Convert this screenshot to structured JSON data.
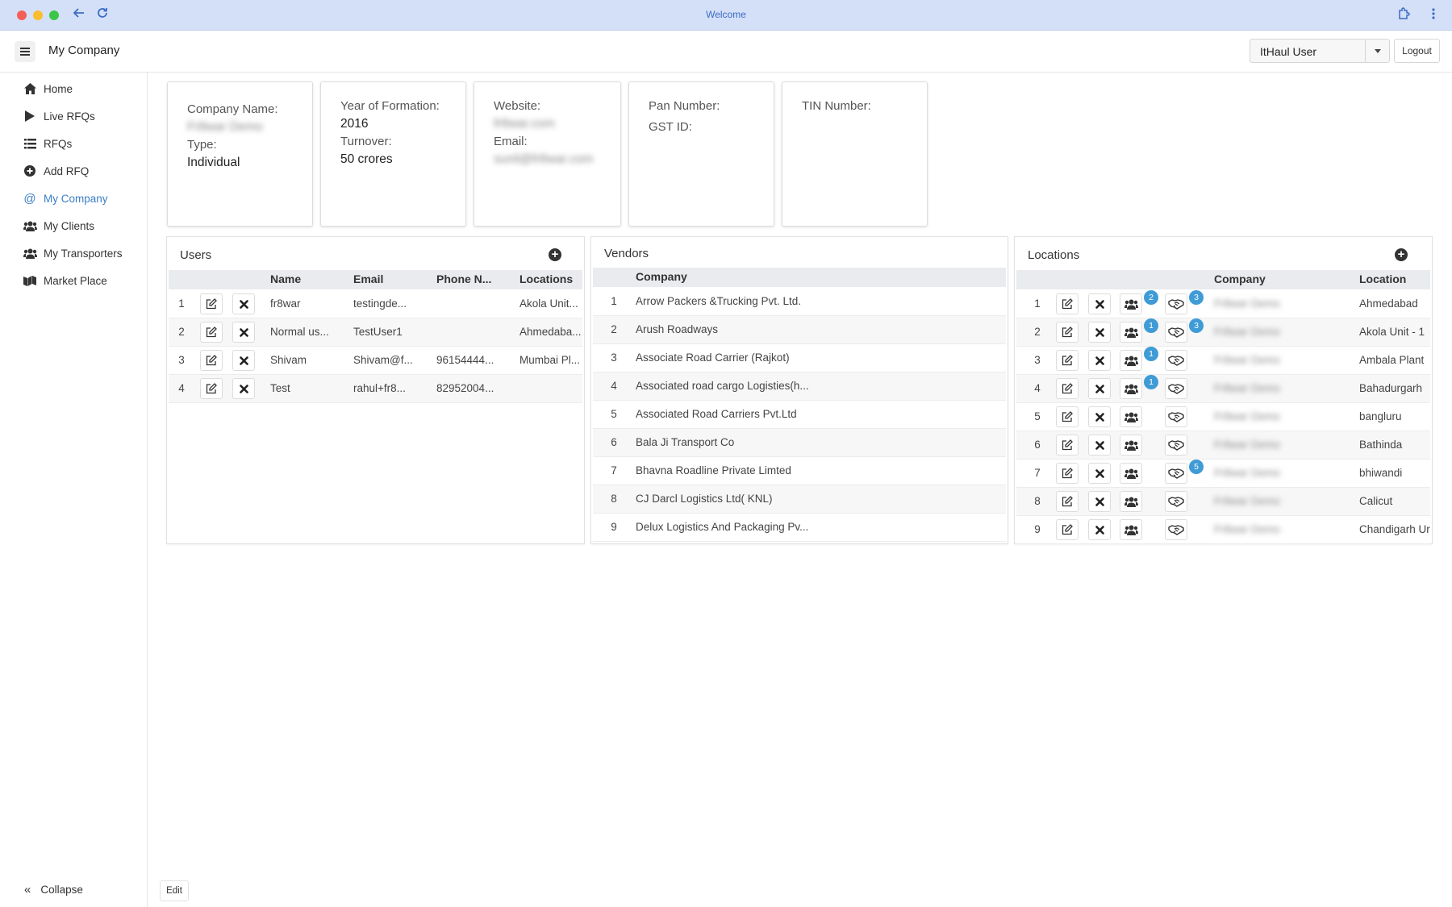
{
  "browser": {
    "title": "Welcome"
  },
  "header": {
    "title": "My Company",
    "user": "ItHaul User",
    "logout_label": "Logout"
  },
  "sidebar": {
    "items": [
      {
        "label": "Home",
        "icon": "home-icon"
      },
      {
        "label": "Live RFQs",
        "icon": "play-icon"
      },
      {
        "label": "RFQs",
        "icon": "list-icon"
      },
      {
        "label": "Add RFQ",
        "icon": "plus-circle-icon"
      },
      {
        "label": "My Company",
        "icon": "at-icon",
        "active": true
      },
      {
        "label": "My Clients",
        "icon": "users-icon"
      },
      {
        "label": "My Transporters",
        "icon": "users-icon"
      },
      {
        "label": "Market Place",
        "icon": "map-icon"
      }
    ],
    "collapse_label": "Collapse"
  },
  "edit_label": "Edit",
  "company": {
    "name_label": "Company Name:",
    "name": "Fr8war Demo",
    "type_label": "Type:",
    "type": "Individual",
    "year_label": "Year of Formation:",
    "year": "2016",
    "turnover_label": "Turnover:",
    "turnover": "50 crores",
    "website_label": "Website:",
    "website": "fr8war.com",
    "email_label": "Email:",
    "email": "sunil@fr8war.com",
    "pan_label": "Pan Number:",
    "gst_label": "GST ID:",
    "tin_label": "TIN Number:"
  },
  "users": {
    "title": "Users",
    "columns": [
      "Name",
      "Email",
      "Phone N...",
      "Locations"
    ],
    "rows": [
      {
        "n": "1",
        "name": "fr8war",
        "email": "testingde...",
        "phone": "",
        "location": "Akola Unit..."
      },
      {
        "n": "2",
        "name": "Normal us...",
        "email": "TestUser1",
        "phone": "",
        "location": "Ahmedaba..."
      },
      {
        "n": "3",
        "name": "Shivam",
        "email": "Shivam@f...",
        "phone": "96154444...",
        "location": "Mumbai Pl..."
      },
      {
        "n": "4",
        "name": "Test",
        "email": "rahul+fr8...",
        "phone": "82952004...",
        "location": ""
      }
    ]
  },
  "vendors": {
    "title": "Vendors",
    "columns": [
      "Company"
    ],
    "rows": [
      {
        "n": "1",
        "company": "Arrow Packers &Trucking Pvt. Ltd."
      },
      {
        "n": "2",
        "company": "Arush Roadways"
      },
      {
        "n": "3",
        "company": "Associate Road Carrier (Rajkot)"
      },
      {
        "n": "4",
        "company": "Associated road cargo Logisties(h..."
      },
      {
        "n": "5",
        "company": "Associated Road Carriers Pvt.Ltd"
      },
      {
        "n": "6",
        "company": "Bala Ji Transport Co"
      },
      {
        "n": "7",
        "company": "Bhavna Roadline Private Limted"
      },
      {
        "n": "8",
        "company": "CJ Darcl Logistics Ltd( KNL)"
      },
      {
        "n": "9",
        "company": "Delux Logistics And Packaging Pv..."
      }
    ]
  },
  "locations": {
    "title": "Locations",
    "columns": [
      "Company",
      "Location"
    ],
    "rows": [
      {
        "n": "1",
        "users_badge": "2",
        "handshake_badge": "3",
        "company": "Fr8war Demo",
        "location": "Ahmedabad"
      },
      {
        "n": "2",
        "users_badge": "1",
        "handshake_badge": "3",
        "company": "Fr8war Demo",
        "location": "Akola Unit - 1"
      },
      {
        "n": "3",
        "users_badge": "1",
        "handshake_badge": "",
        "company": "Fr8war Demo",
        "location": "Ambala Plant"
      },
      {
        "n": "4",
        "users_badge": "1",
        "handshake_badge": "",
        "company": "Fr8war Demo",
        "location": "Bahadurgarh"
      },
      {
        "n": "5",
        "users_badge": "",
        "handshake_badge": "",
        "company": "Fr8war Demo",
        "location": "bangluru"
      },
      {
        "n": "6",
        "users_badge": "",
        "handshake_badge": "",
        "company": "Fr8war Demo",
        "location": "Bathinda"
      },
      {
        "n": "7",
        "users_badge": "",
        "handshake_badge": "5",
        "company": "Fr8war Demo",
        "location": "bhiwandi"
      },
      {
        "n": "8",
        "users_badge": "",
        "handshake_badge": "",
        "company": "Fr8war Demo",
        "location": "Calicut"
      },
      {
        "n": "9",
        "users_badge": "",
        "handshake_badge": "",
        "company": "Fr8war Demo",
        "location": "Chandigarh Ur"
      }
    ]
  },
  "colors": {
    "accent": "#3b7ec6",
    "badge": "#3f9bd6",
    "chrome": "#d4e0f7"
  }
}
